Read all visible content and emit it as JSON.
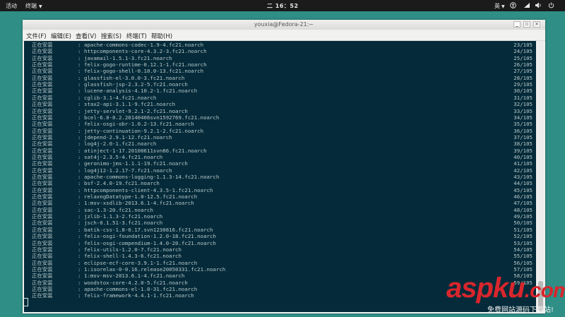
{
  "topbar": {
    "activities": "活动",
    "app_menu": "终端",
    "clock": "二 16：52",
    "input_method": "英"
  },
  "window": {
    "title": "youxia@Fedora-21:~",
    "menus": [
      "文件(F)",
      "编辑(E)",
      "查看(V)",
      "搜索(S)",
      "终端(T)",
      "帮助(H)"
    ]
  },
  "terminal": {
    "lines": [
      {
        "status": "正在安装",
        "sep": ":",
        "pkg": "apache-commons-codec-1.9-4.fc21.noarch",
        "progress": "23/105"
      },
      {
        "status": "正在安装",
        "sep": ":",
        "pkg": "httpcomponents-core-4.3.2-3.fc21.noarch",
        "progress": "24/105"
      },
      {
        "status": "正在安装",
        "sep": ":",
        "pkg": "javamail-1.5.1-3.fc21.noarch",
        "progress": "25/105"
      },
      {
        "status": "正在安装",
        "sep": ":",
        "pkg": "felix-gogo-runtime-0.12.1-1.fc21.noarch",
        "progress": "26/105"
      },
      {
        "status": "正在安装",
        "sep": ":",
        "pkg": "felix-gogo-shell-0.10.0-13.fc21.noarch",
        "progress": "27/105"
      },
      {
        "status": "正在安装",
        "sep": ":",
        "pkg": "glassfish-el-3.0.0-3.fc21.noarch",
        "progress": "28/105"
      },
      {
        "status": "正在安装",
        "sep": ":",
        "pkg": "glassfish-jsp-2.3.2-5.fc21.noarch",
        "progress": "29/105"
      },
      {
        "status": "正在安装",
        "sep": ":",
        "pkg": "lucene-analysis-4.10.2-1.fc21.noarch",
        "progress": "30/105"
      },
      {
        "status": "正在安装",
        "sep": ":",
        "pkg": "cglib-3.1-4.fc21.noarch",
        "progress": "31/105"
      },
      {
        "status": "正在安装",
        "sep": ":",
        "pkg": "stax2-api-3.1.1-9.fc21.noarch",
        "progress": "32/105"
      },
      {
        "status": "正在安装",
        "sep": ":",
        "pkg": "jetty-servlet-9.2.1-2.fc21.noarch",
        "progress": "33/105"
      },
      {
        "status": "正在安装",
        "sep": ":",
        "pkg": "bcel-6.0-0.2.20140406svn1592769.fc21.noarch",
        "progress": "34/105"
      },
      {
        "status": "正在安装",
        "sep": ":",
        "pkg": "felix-osgi-obr-1.0.2-13.fc21.noarch",
        "progress": "35/105"
      },
      {
        "status": "正在安装",
        "sep": ":",
        "pkg": "jetty-continuation-9.2.1-2.fc21.noarch",
        "progress": "36/105"
      },
      {
        "status": "正在安装",
        "sep": ":",
        "pkg": "jdepend-2.9.1-12.fc21.noarch",
        "progress": "37/105"
      },
      {
        "status": "正在安装",
        "sep": ":",
        "pkg": "log4j-2.0-1.fc21.noarch",
        "progress": "38/105"
      },
      {
        "status": "正在安装",
        "sep": ":",
        "pkg": "atinject-1-17.20100611svn86.fc21.noarch",
        "progress": "39/105"
      },
      {
        "status": "正在安装",
        "sep": ":",
        "pkg": "sat4j-2.3.5-4.fc21.noarch",
        "progress": "40/105"
      },
      {
        "status": "正在安装",
        "sep": ":",
        "pkg": "geronimo-jms-1.1.1-19.fc21.noarch",
        "progress": "41/105"
      },
      {
        "status": "正在安装",
        "sep": ":",
        "pkg": "log4j12-1.2.17-7.fc21.noarch",
        "progress": "42/105"
      },
      {
        "status": "正在安装",
        "sep": ":",
        "pkg": "apache-commons-logging-1.1.3-14.fc21.noarch",
        "progress": "43/105"
      },
      {
        "status": "正在安装",
        "sep": ":",
        "pkg": "bsf-2.4.0-19.fc21.noarch",
        "progress": "44/105"
      },
      {
        "status": "正在安装",
        "sep": ":",
        "pkg": "httpcomponents-client-4.3.5-1.fc21.noarch",
        "progress": "45/105"
      },
      {
        "status": "正在安装",
        "sep": ":",
        "pkg": "relaxngDatatype-1.0-12.5.fc21.noarch",
        "progress": "46/105"
      },
      {
        "status": "正在安装",
        "sep": ":",
        "pkg": "1:msv-xsdlib-2013.6.1-4.fc21.noarch",
        "progress": "47/105"
      },
      {
        "status": "正在安装",
        "sep": ":",
        "pkg": "sac-1.3-20.fc21.noarch",
        "progress": "48/105"
      },
      {
        "status": "正在安装",
        "sep": ":",
        "pkg": "jzlib-1.1.3-2.fc21.noarch",
        "progress": "49/105"
      },
      {
        "status": "正在安装",
        "sep": ":",
        "pkg": "jsch-0.1.51-3.fc21.noarch",
        "progress": "50/105"
      },
      {
        "status": "正在安装",
        "sep": ":",
        "pkg": "batik-css-1.8-0.17.svn1230816.fc21.noarch",
        "progress": "51/105"
      },
      {
        "status": "正在安装",
        "sep": ":",
        "pkg": "felix-osgi-foundation-1.2.0-18.fc21.noarch",
        "progress": "52/105"
      },
      {
        "status": "正在安装",
        "sep": ":",
        "pkg": "felix-osgi-compendium-1.4.0-20.fc21.noarch",
        "progress": "53/105"
      },
      {
        "status": "正在安装",
        "sep": ":",
        "pkg": "felix-utils-1.2.0-7.fc21.noarch",
        "progress": "54/105"
      },
      {
        "status": "正在安装",
        "sep": ":",
        "pkg": "felix-shell-1.4.3-6.fc21.noarch",
        "progress": "55/105"
      },
      {
        "status": "正在安装",
        "sep": ":",
        "pkg": "eclipse-ecf-core-3.9.1-1.fc21.noarch",
        "progress": "56/105"
      },
      {
        "status": "正在安装",
        "sep": ":",
        "pkg": "1:isorelax-0-0.16.release20050331.fc21.noarch",
        "progress": "57/105"
      },
      {
        "status": "正在安装",
        "sep": ":",
        "pkg": "1:msv-msv-2013.6.1-4.fc21.noarch",
        "progress": "58/105"
      },
      {
        "status": "正在安装",
        "sep": ":",
        "pkg": "woodstox-core-4.2.0-5.fc21.noarch",
        "progress": "59/105"
      },
      {
        "status": "正在安装",
        "sep": ":",
        "pkg": "apache-commons-el-1.0-31.fc21.noarch",
        "progress": ""
      },
      {
        "status": "正在安装",
        "sep": ":",
        "pkg": "felix-framework-4.4.1-1.fc21.noarch",
        "progress": ""
      }
    ]
  },
  "watermark": {
    "main": "aspku",
    "suffix": ".com",
    "sub": "免费网站源码下载站!"
  },
  "colors": {
    "desktop": "#2f8f86",
    "terminal_bg": "#052b3a",
    "terminal_fg": "#b8c8ca",
    "watermark": "#d9262c"
  }
}
